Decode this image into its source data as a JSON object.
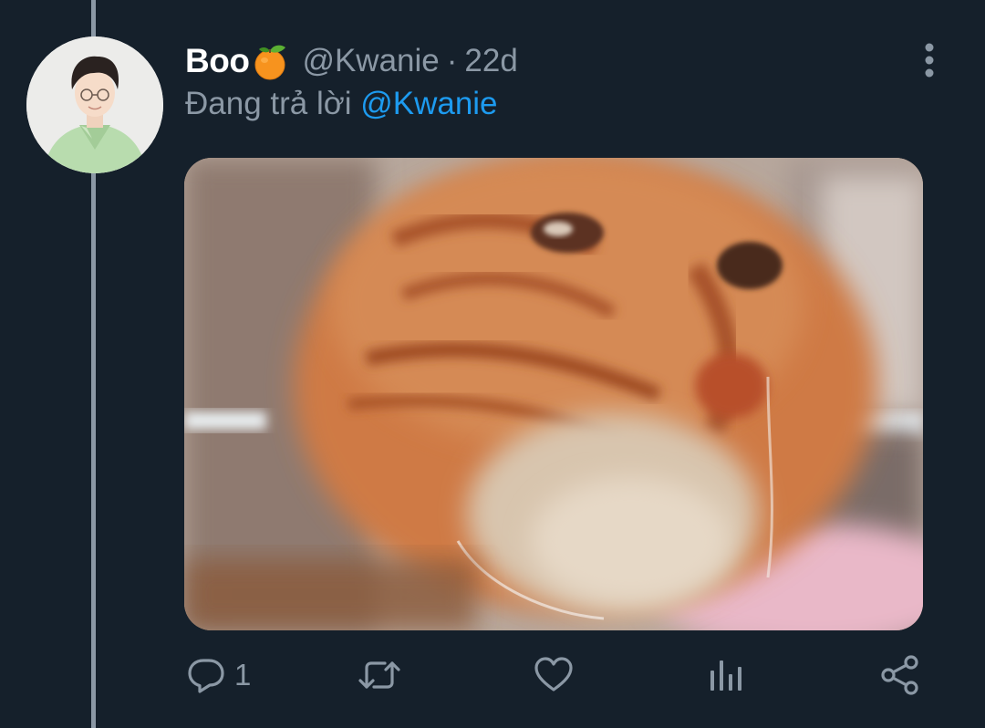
{
  "tweet": {
    "display_name": "Boo",
    "name_emoji": "tangerine-emoji",
    "handle": "@Kwanie",
    "separator": "·",
    "timestamp": "22d",
    "reply_prefix": "Đang trả lời",
    "reply_mention": "@Kwanie",
    "media_description_icon": "cat-photo",
    "actions": {
      "reply_icon": "speech-bubble-icon",
      "reply_count": "1",
      "retweet_icon": "retweet-icon",
      "like_icon": "heart-icon",
      "analytics_icon": "bar-chart-icon",
      "share_icon": "share-icon"
    }
  },
  "colors": {
    "background": "#15202b",
    "primary_text": "#ffffff",
    "secondary_text": "#8b98a5",
    "link": "#1d9bf0",
    "thread_line": "#8b98a5"
  }
}
